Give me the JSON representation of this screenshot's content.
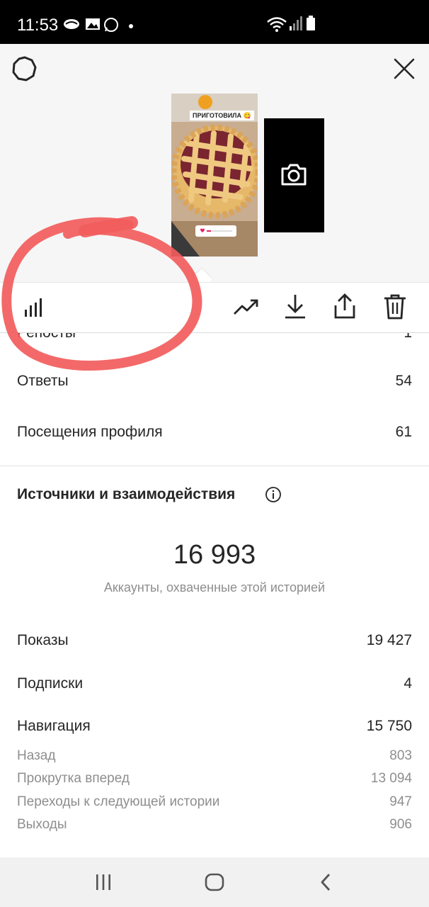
{
  "status_bar": {
    "time": "11:53",
    "icons": [
      "messenger-icon",
      "gallery-notification-icon",
      "whatsapp-icon",
      "dot-icon",
      "wifi-icon",
      "signal-icon",
      "battery-icon"
    ]
  },
  "header": {
    "settings_icon": "gear-icon",
    "close_icon": "close-icon",
    "story_label": "ПРИГОТОВИЛА 😋",
    "next_story_icon": "camera-icon"
  },
  "toolbar": {
    "icons": [
      "insights-bars-icon",
      "promote-trend-icon",
      "download-icon",
      "share-icon",
      "delete-icon"
    ]
  },
  "metrics_top": [
    {
      "label": "Ответы",
      "value": "54"
    },
    {
      "label": "Посещения профиля",
      "value": "61"
    }
  ],
  "section": {
    "title": "Источники и взаимодействия",
    "reach_value": "16 993",
    "reach_caption": "Аккаунты, охваченные этой историей"
  },
  "metrics_main": [
    {
      "label": "Показы",
      "value": "19 427"
    },
    {
      "label": "Подписки",
      "value": "4"
    },
    {
      "label": "Навигация",
      "value": "15 750"
    }
  ],
  "navigation_details": [
    {
      "label": "Назад",
      "value": "803"
    },
    {
      "label": "Прокрутка вперед",
      "value": "13 094"
    },
    {
      "label": "Переходы к следующей истории",
      "value": "947"
    },
    {
      "label": "Выходы",
      "value": "906"
    }
  ],
  "colors": {
    "highlight": "#f25c5c",
    "text": "#262626",
    "muted": "#8e8e8e"
  }
}
